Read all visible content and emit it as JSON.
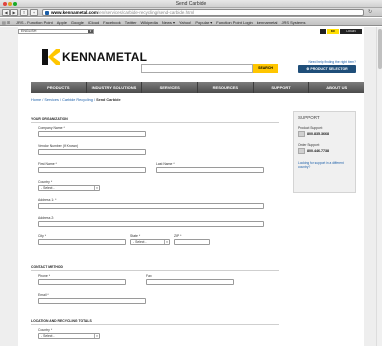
{
  "window": {
    "title": "Send Carbide"
  },
  "address": {
    "url_domain": "www.kennametal.com",
    "url_path": "/en/services/carbide-recycling/send-carbide.html",
    "reload_icon": "reload-icon"
  },
  "bookmarks": [
    "JRS - Function Point",
    "Apple",
    "Google",
    "iCloud",
    "Facebook",
    "Twitter",
    "Wikipedia",
    "News ▾",
    "Yahoo!",
    "Popular ▾",
    "Function Point Login",
    "kennametal",
    "JRS Systems"
  ],
  "utility": {
    "language": "ENGLISH",
    "kc_badge": "KC",
    "login_label": "LOGIN"
  },
  "brand": {
    "name": "KENNAMETAL",
    "color": "#ffc600"
  },
  "search": {
    "button_label": "SEARCH",
    "placeholder": ""
  },
  "product_help": {
    "text": "Need help finding the right item?",
    "button_label": "PRODUCT SELECTOR"
  },
  "nav": [
    "PRODUCTS",
    "INDUSTRY SOLUTIONS",
    "SERVICES",
    "RESOURCES",
    "SUPPORT",
    "ABOUT US"
  ],
  "breadcrumb": {
    "home": "Home",
    "services": "Services",
    "recycling": "Carbide Recycling",
    "current": "Send Carbide",
    "sep": "/"
  },
  "sections": {
    "org": "YOUR ORGANIZATION",
    "contact": "CONTACT METHOD",
    "location": "LOCATION AND RECYCLING TOTALS"
  },
  "form": {
    "company": "Company Name *",
    "vendor": "Vendor Number (If Known)",
    "first": "First Name *",
    "last": "Last Name *",
    "country": "Country *",
    "select_default": "- Select -",
    "address1": "Address 1: *",
    "address2": "Address 2:",
    "city": "City *",
    "state": "State *",
    "zip": "ZIP *",
    "phone": "Phone *",
    "fax": "Fax",
    "email": "Email *",
    "country2": "Country *"
  },
  "support": {
    "heading": "SUPPORT",
    "product_label": "Product Support:",
    "product_phone": "800.835.3668",
    "order_label": "Order Support:",
    "order_phone": "800.446.7738",
    "link": "Looking for support in a different country?"
  }
}
